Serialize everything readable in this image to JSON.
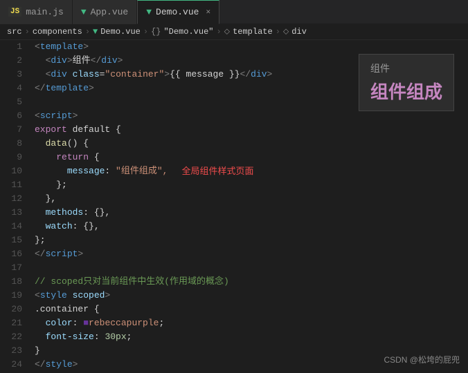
{
  "tabs": [
    {
      "id": "main-js",
      "label": "main.js",
      "icon": "JS",
      "active": false,
      "closable": false
    },
    {
      "id": "app-vue",
      "label": "App.vue",
      "icon": "vue",
      "active": false,
      "closable": false
    },
    {
      "id": "demo-vue",
      "label": "Demo.vue",
      "icon": "vue",
      "active": true,
      "closable": true
    }
  ],
  "breadcrumb": {
    "parts": [
      "src",
      "components",
      "Demo.vue",
      "{} \"Demo.vue\"",
      "template",
      "div"
    ]
  },
  "lines": [
    {
      "num": 1,
      "tokens": [
        {
          "t": "<",
          "c": "c-tag"
        },
        {
          "t": "template",
          "c": "c-tagname"
        },
        {
          "t": ">",
          "c": "c-tag"
        }
      ]
    },
    {
      "num": 2,
      "tokens": [
        {
          "t": "  ",
          "c": "c-white"
        },
        {
          "t": "<",
          "c": "c-tag"
        },
        {
          "t": "div",
          "c": "c-tagname"
        },
        {
          "t": ">",
          "c": "c-tag"
        },
        {
          "t": "组件",
          "c": "c-text"
        },
        {
          "t": "</",
          "c": "c-tag"
        },
        {
          "t": "div",
          "c": "c-tagname"
        },
        {
          "t": ">",
          "c": "c-tag"
        }
      ]
    },
    {
      "num": 3,
      "tokens": [
        {
          "t": "  ",
          "c": "c-white"
        },
        {
          "t": "<",
          "c": "c-tag"
        },
        {
          "t": "div",
          "c": "c-tagname"
        },
        {
          "t": " ",
          "c": "c-white"
        },
        {
          "t": "class",
          "c": "c-attr"
        },
        {
          "t": "=",
          "c": "c-white"
        },
        {
          "t": "\"container\"",
          "c": "c-string"
        },
        {
          "t": ">",
          "c": "c-tag"
        },
        {
          "t": "{{ message }}",
          "c": "c-mustache"
        },
        {
          "t": "</",
          "c": "c-tag"
        },
        {
          "t": "div",
          "c": "c-tagname"
        },
        {
          "t": ">",
          "c": "c-tag"
        }
      ]
    },
    {
      "num": 4,
      "tokens": [
        {
          "t": "</",
          "c": "c-tag"
        },
        {
          "t": "template",
          "c": "c-tagname"
        },
        {
          "t": ">",
          "c": "c-tag"
        }
      ]
    },
    {
      "num": 5,
      "tokens": []
    },
    {
      "num": 6,
      "tokens": [
        {
          "t": "<",
          "c": "c-tag"
        },
        {
          "t": "script",
          "c": "c-tagname"
        },
        {
          "t": ">",
          "c": "c-tag"
        }
      ]
    },
    {
      "num": 7,
      "tokens": [
        {
          "t": "export ",
          "c": "c-keyword"
        },
        {
          "t": "default ",
          "c": "c-white"
        },
        {
          "t": "{",
          "c": "c-white"
        }
      ]
    },
    {
      "num": 8,
      "tokens": [
        {
          "t": "  ",
          "c": "c-white"
        },
        {
          "t": "data",
          "c": "c-func"
        },
        {
          "t": "() ",
          "c": "c-white"
        },
        {
          "t": "{",
          "c": "c-white"
        }
      ]
    },
    {
      "num": 9,
      "tokens": [
        {
          "t": "    ",
          "c": "c-white"
        },
        {
          "t": "return ",
          "c": "c-keyword"
        },
        {
          "t": "{",
          "c": "c-white"
        }
      ]
    },
    {
      "num": 10,
      "tokens": [
        {
          "t": "      ",
          "c": "c-white"
        },
        {
          "t": "message",
          "c": "c-prop"
        },
        {
          "t": ": ",
          "c": "c-white"
        },
        {
          "t": "\"组件组成\",",
          "c": "c-string"
        }
      ],
      "annotation": "全局组件样式页面"
    },
    {
      "num": 11,
      "tokens": [
        {
          "t": "    ",
          "c": "c-white"
        },
        {
          "t": "};",
          "c": "c-white"
        }
      ]
    },
    {
      "num": 12,
      "tokens": [
        {
          "t": "  ",
          "c": "c-white"
        },
        {
          "t": "},",
          "c": "c-white"
        }
      ]
    },
    {
      "num": 13,
      "tokens": [
        {
          "t": "  ",
          "c": "c-white"
        },
        {
          "t": "methods",
          "c": "c-prop"
        },
        {
          "t": ": ",
          "c": "c-white"
        },
        {
          "t": "{}",
          "c": "c-white"
        },
        {
          "t": ",",
          "c": "c-white"
        }
      ]
    },
    {
      "num": 14,
      "tokens": [
        {
          "t": "  ",
          "c": "c-white"
        },
        {
          "t": "watch",
          "c": "c-prop"
        },
        {
          "t": ": ",
          "c": "c-white"
        },
        {
          "t": "{}",
          "c": "c-white"
        },
        {
          "t": ",",
          "c": "c-white"
        }
      ]
    },
    {
      "num": 15,
      "tokens": [
        {
          "t": "};",
          "c": "c-white"
        }
      ]
    },
    {
      "num": 16,
      "tokens": [
        {
          "t": "</",
          "c": "c-tag"
        },
        {
          "t": "script",
          "c": "c-tagname"
        },
        {
          "t": ">",
          "c": "c-tag"
        }
      ]
    },
    {
      "num": 17,
      "tokens": []
    },
    {
      "num": 18,
      "tokens": [
        {
          "t": "// scoped只对当前组件中生效(作用域的概念)",
          "c": "c-comment"
        }
      ]
    },
    {
      "num": 19,
      "tokens": [
        {
          "t": "<",
          "c": "c-tag"
        },
        {
          "t": "style",
          "c": "c-tagname"
        },
        {
          "t": " ",
          "c": "c-white"
        },
        {
          "t": "scoped",
          "c": "c-attr"
        },
        {
          "t": ">",
          "c": "c-tag"
        }
      ]
    },
    {
      "num": 20,
      "tokens": [
        {
          "t": ".container ",
          "c": "c-white"
        },
        {
          "t": "{",
          "c": "c-white"
        }
      ]
    },
    {
      "num": 21,
      "tokens": [
        {
          "t": "  ",
          "c": "c-white"
        },
        {
          "t": "color",
          "c": "c-prop"
        },
        {
          "t": ": ",
          "c": "c-white"
        },
        {
          "t": "■",
          "c": "c-purple"
        },
        {
          "t": "rebeccapurple",
          "c": "c-value"
        },
        {
          "t": ";",
          "c": "c-white"
        }
      ]
    },
    {
      "num": 22,
      "tokens": [
        {
          "t": "  ",
          "c": "c-white"
        },
        {
          "t": "font-size",
          "c": "c-prop"
        },
        {
          "t": ": ",
          "c": "c-white"
        },
        {
          "t": "30px",
          "c": "c-number"
        },
        {
          "t": ";",
          "c": "c-white"
        }
      ]
    },
    {
      "num": 23,
      "tokens": [
        {
          "t": "}",
          "c": "c-white"
        }
      ]
    },
    {
      "num": 24,
      "tokens": [
        {
          "t": "</",
          "c": "c-tag"
        },
        {
          "t": "style",
          "c": "c-tagname"
        },
        {
          "t": ">",
          "c": "c-tag"
        }
      ]
    }
  ],
  "tooltip": {
    "title": "组件",
    "main": "组件组成"
  },
  "watermark": "CSDN @松垮的屁兜"
}
